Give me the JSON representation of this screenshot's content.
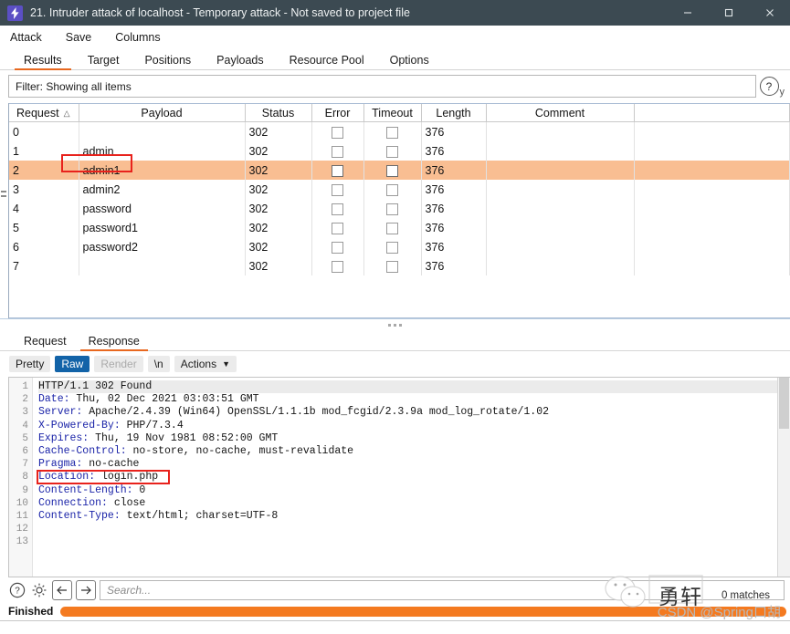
{
  "window": {
    "title": "21. Intruder attack of localhost - Temporary attack - Not saved to project file",
    "icon": "lightning-bolt-icon",
    "minimize": "—",
    "maximize": "□",
    "close": "✕"
  },
  "menubar": {
    "items": [
      {
        "label": "Attack"
      },
      {
        "label": "Save"
      },
      {
        "label": "Columns"
      }
    ]
  },
  "tabs": {
    "active": "Results",
    "items": [
      {
        "label": "Results"
      },
      {
        "label": "Target"
      },
      {
        "label": "Positions"
      },
      {
        "label": "Payloads"
      },
      {
        "label": "Resource Pool"
      },
      {
        "label": "Options"
      }
    ]
  },
  "filter": {
    "text": "Filter: Showing all items",
    "help_icon": "question-mark-icon",
    "edge_label": "y"
  },
  "results_table": {
    "columns": [
      {
        "label": "Request",
        "sort": "▲"
      },
      {
        "label": "Payload"
      },
      {
        "label": "Status"
      },
      {
        "label": "Error"
      },
      {
        "label": "Timeout"
      },
      {
        "label": "Length"
      },
      {
        "label": "Comment"
      }
    ],
    "rows": [
      {
        "request": "0",
        "payload": "",
        "status": "302",
        "error": false,
        "timeout": false,
        "length": "376",
        "comment": "",
        "selected": false
      },
      {
        "request": "1",
        "payload": "admin",
        "status": "302",
        "error": false,
        "timeout": false,
        "length": "376",
        "comment": "",
        "selected": false
      },
      {
        "request": "2",
        "payload": "admin1",
        "status": "302",
        "error": false,
        "timeout": false,
        "length": "376",
        "comment": "",
        "selected": true
      },
      {
        "request": "3",
        "payload": "admin2",
        "status": "302",
        "error": false,
        "timeout": false,
        "length": "376",
        "comment": "",
        "selected": false
      },
      {
        "request": "4",
        "payload": "password",
        "status": "302",
        "error": false,
        "timeout": false,
        "length": "376",
        "comment": "",
        "selected": false
      },
      {
        "request": "5",
        "payload": "password1",
        "status": "302",
        "error": false,
        "timeout": false,
        "length": "376",
        "comment": "",
        "selected": false
      },
      {
        "request": "6",
        "payload": "password2",
        "status": "302",
        "error": false,
        "timeout": false,
        "length": "376",
        "comment": "",
        "selected": false
      },
      {
        "request": "7",
        "payload": "",
        "status": "302",
        "error": false,
        "timeout": false,
        "length": "376",
        "comment": "",
        "selected": false
      }
    ]
  },
  "detail_tabs": {
    "active": "Response",
    "items": [
      {
        "label": "Request"
      },
      {
        "label": "Response"
      }
    ]
  },
  "view_toolbar": {
    "buttons": [
      {
        "label": "Pretty",
        "state": "normal"
      },
      {
        "label": "Raw",
        "state": "selected"
      },
      {
        "label": "Render",
        "state": "disabled"
      },
      {
        "label": "\\n",
        "state": "normal"
      },
      {
        "label": "Actions",
        "state": "normal",
        "caret": "⌄"
      }
    ]
  },
  "response": {
    "line_numbers": [
      "1",
      "2",
      "3",
      "4",
      "5",
      "6",
      "7",
      "8",
      "9",
      "10",
      "11",
      "12",
      "13"
    ],
    "lines": [
      {
        "header": "",
        "value": "HTTP/1.1 302 Found",
        "highlight": true
      },
      {
        "header": "Date:",
        "value": " Thu, 02 Dec 2021 03:03:51 GMT"
      },
      {
        "header": "Server:",
        "value": " Apache/2.4.39 (Win64) OpenSSL/1.1.1b mod_fcgid/2.3.9a mod_log_rotate/1.02"
      },
      {
        "header": "X-Powered-By:",
        "value": " PHP/7.3.4"
      },
      {
        "header": "Expires:",
        "value": " Thu, 19 Nov 1981 08:52:00 GMT"
      },
      {
        "header": "Cache-Control:",
        "value": " no-store, no-cache, must-revalidate"
      },
      {
        "header": "Pragma:",
        "value": " no-cache"
      },
      {
        "header": "Location:",
        "value": " login.php"
      },
      {
        "header": "Content-Length:",
        "value": " 0"
      },
      {
        "header": "Connection:",
        "value": " close"
      },
      {
        "header": "Content-Type:",
        "value": " text/html; charset=UTF-8"
      },
      {
        "header": "",
        "value": ""
      },
      {
        "header": "",
        "value": ""
      }
    ]
  },
  "bottom_toolbar": {
    "help_icon": "question-mark-icon",
    "settings_icon": "gear-icon",
    "back_icon": "arrow-left-icon",
    "forward_icon": "arrow-right-icon",
    "search_placeholder": "Search...",
    "matches": "0 matches"
  },
  "status": {
    "label": "Finished",
    "progress_percent": 100
  },
  "annotations": [
    {
      "name": "payload-highlight",
      "target": "admin1",
      "color": "#e8221c"
    },
    {
      "name": "location-highlight",
      "target": "Location: login.php",
      "color": "#e8221c"
    }
  ],
  "watermarks": {
    "chinese": "勇轩",
    "csdn": "CSDN @Spring口胡"
  },
  "colors": {
    "titlebar": "#3c4a52",
    "accent": "#e8681f",
    "selected_row": "#f9be92",
    "progress": "#f47a20",
    "header_key": "#1a23a8",
    "annotation": "#e8221c",
    "raw_selected": "#1263a8"
  }
}
